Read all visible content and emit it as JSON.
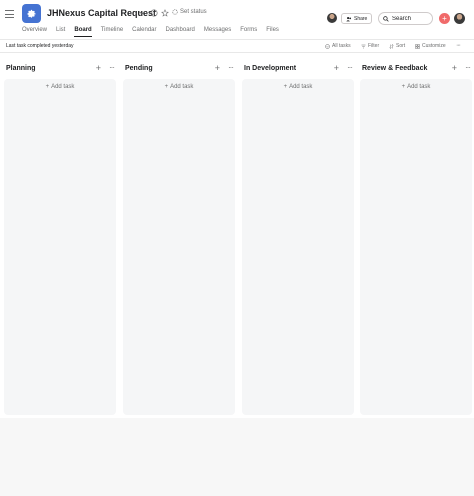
{
  "project": {
    "title": "JHNexus Capital Request",
    "set_status": "Set status"
  },
  "header": {
    "share_label": "Share",
    "search_placeholder": "Search"
  },
  "tabs": [
    {
      "label": "Overview"
    },
    {
      "label": "List"
    },
    {
      "label": "Board",
      "active": true
    },
    {
      "label": "Timeline"
    },
    {
      "label": "Calendar"
    },
    {
      "label": "Dashboard"
    },
    {
      "label": "Messages"
    },
    {
      "label": "Forms"
    },
    {
      "label": "Files"
    }
  ],
  "toolbar": {
    "last_completed": "Last task completed yesterday",
    "all_tasks": "All tasks",
    "filter": "Filter",
    "sort": "Sort",
    "customize": "Customize"
  },
  "columns": [
    {
      "title": "Planning",
      "add_task": "Add task"
    },
    {
      "title": "Pending",
      "add_task": "Add task"
    },
    {
      "title": "In Development",
      "add_task": "Add task"
    },
    {
      "title": "Review & Feedback",
      "add_task": "Add task"
    }
  ],
  "colors": {
    "accent": "#f06a6a",
    "app_icon": "#4573d2",
    "column_bg": "#f5f6f7"
  },
  "icons": [
    "hamburger-icon",
    "gear-icon",
    "chevron-down-icon",
    "info-icon",
    "star-icon",
    "status-icon",
    "share-icon",
    "search-icon",
    "plus-icon",
    "more-icon",
    "check-circle-icon",
    "filter-icon",
    "sort-icon",
    "customize-icon"
  ]
}
